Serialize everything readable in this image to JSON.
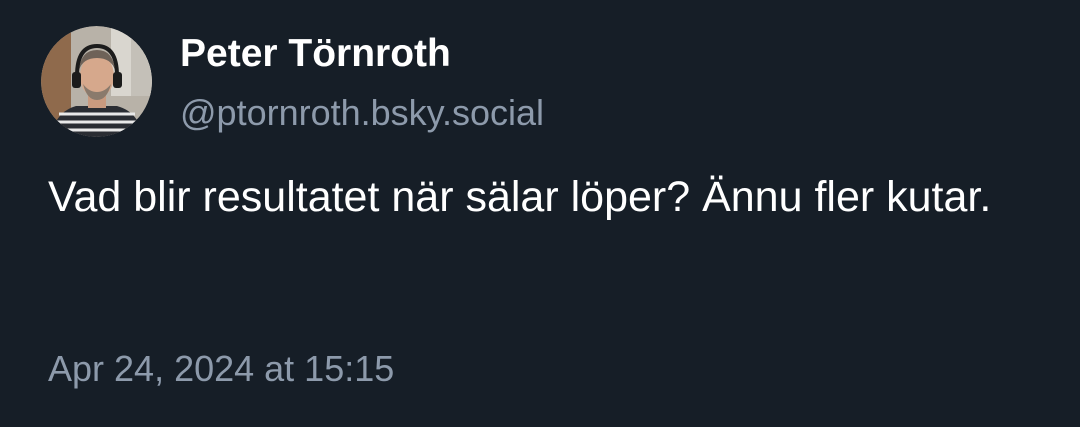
{
  "author": {
    "display_name": "Peter Törnroth",
    "handle": "@ptornroth.bsky.social",
    "avatar_icon": "user-avatar-photo"
  },
  "post": {
    "text": "Vad blir resultatet när sälar löper? Ännu fler kutar.",
    "timestamp": "Apr 24, 2024 at 15:15"
  },
  "colors": {
    "background": "#161e27",
    "primary_text": "#ffffff",
    "secondary_text": "#8d9aab"
  }
}
